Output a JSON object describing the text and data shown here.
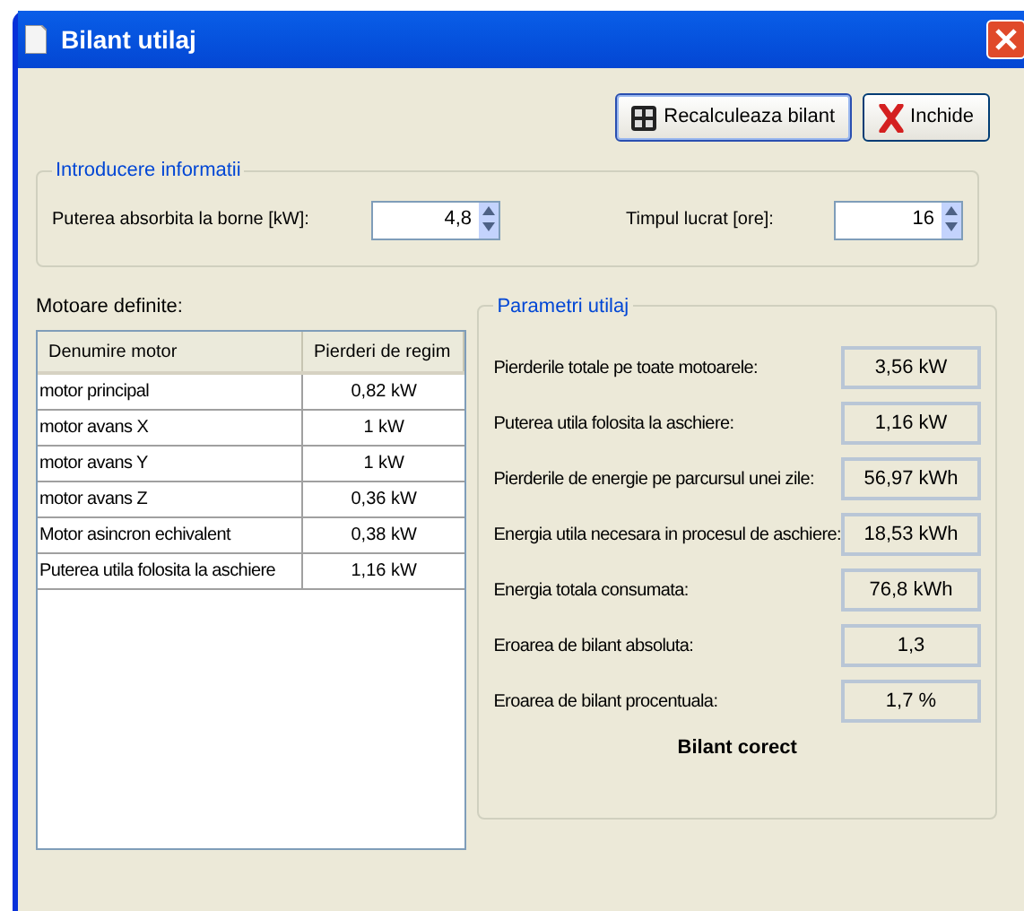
{
  "window": {
    "title": "Bilant utilaj"
  },
  "buttons": [
    {
      "label": "Recalculeaza bilant",
      "kind": "recalc",
      "focused": true
    },
    {
      "label": "Inchide",
      "kind": "close",
      "focused": false
    }
  ],
  "input_group": {
    "title": "Introducere informatii",
    "fields": [
      {
        "label": "Puterea absorbita la borne [kW]:",
        "value": "4,8"
      },
      {
        "label": "Timpul lucrat [ore]:",
        "value": "16"
      }
    ]
  },
  "motors": {
    "label": "Motoare definite:",
    "columns": [
      "Denumire motor",
      "Pierderi de regim"
    ],
    "rows": [
      [
        "motor principal",
        "0,82 kW"
      ],
      [
        "motor avans X",
        "1 kW"
      ],
      [
        "motor avans Y",
        "1 kW"
      ],
      [
        "motor avans Z",
        "0,36 kW"
      ],
      [
        "Motor asincron echivalent",
        "0,38 kW"
      ],
      [
        "Puterea utila folosita la aschiere",
        "1,16 kW"
      ]
    ]
  },
  "parameters": {
    "title": "Parametri utilaj",
    "items": [
      {
        "label": "Pierderile totale pe toate motoarele:",
        "value": "3,56 kW"
      },
      {
        "label": "Puterea utila folosita la aschiere:",
        "value": "1,16 kW"
      },
      {
        "label": "Pierderile de energie pe parcursul unei zile:",
        "value": "56,97 kWh"
      },
      {
        "label": "Energia utila necesara in procesul de aschiere:",
        "value": "18,53 kWh"
      },
      {
        "label": "Energia totala consumata:",
        "value": "76,8 kWh"
      },
      {
        "label": "Eroarea de bilant absoluta:",
        "value": "1,3"
      },
      {
        "label": "Eroarea de bilant procentuala:",
        "value": "1,7 %"
      }
    ],
    "verdict": "Bilant corect"
  }
}
